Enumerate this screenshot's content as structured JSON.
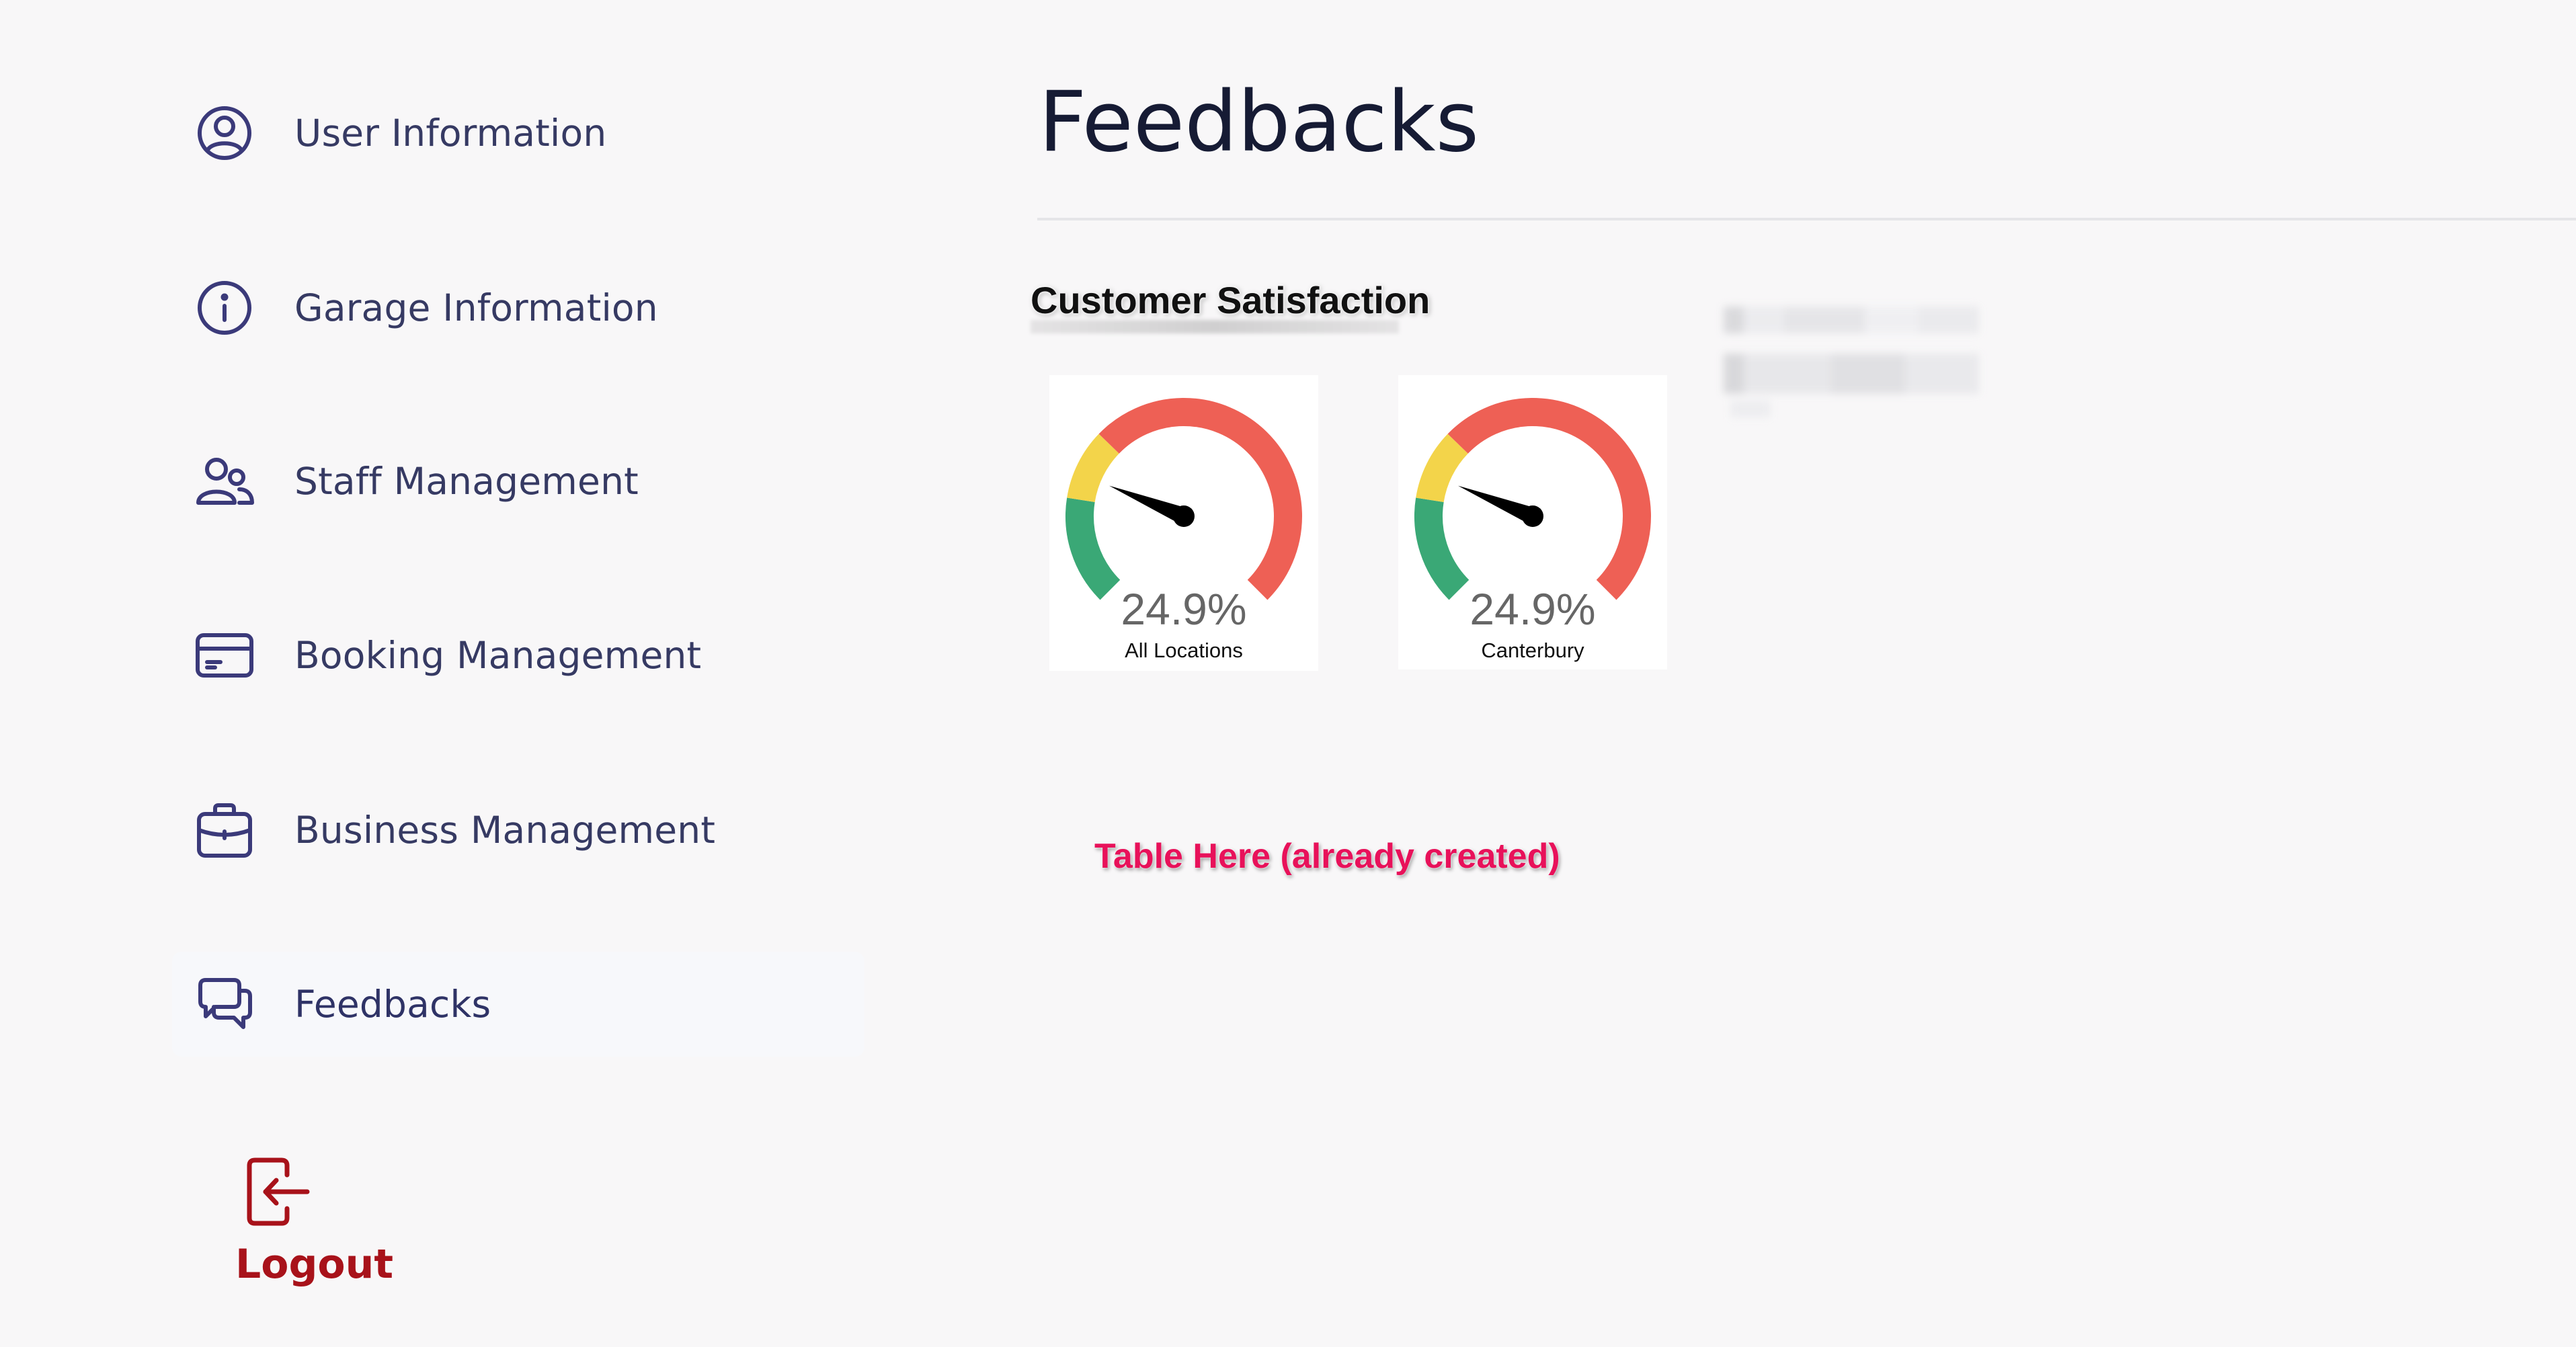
{
  "sidebar": {
    "items": [
      {
        "label": "User Information",
        "icon": "user-circle-icon"
      },
      {
        "label": "Garage Information",
        "icon": "info-icon"
      },
      {
        "label": "Staff Management",
        "icon": "users-icon"
      },
      {
        "label": "Booking Management",
        "icon": "credit-card-icon"
      },
      {
        "label": "Business Management",
        "icon": "briefcase-icon"
      },
      {
        "label": "Feedbacks",
        "icon": "chat-bubbles-icon",
        "active": true
      }
    ],
    "logout": {
      "label": "Logout",
      "icon": "logout-icon"
    }
  },
  "main": {
    "title": "Feedbacks",
    "section_title": "Customer Satisfaction",
    "table_placeholder": "Table Here (already created)"
  },
  "gauges": [
    {
      "value": "24.9%",
      "label": "All Locations",
      "percent": 24.9
    },
    {
      "value": "24.9%",
      "label": "Canterbury",
      "percent": 24.9
    }
  ],
  "colors": {
    "icon": "#3b3a7a",
    "logout": "#a8121a",
    "gauge_green": "#3aa876",
    "gauge_yellow": "#f3d44a",
    "gauge_red": "#ee6055",
    "placeholder": "#e8115a"
  }
}
